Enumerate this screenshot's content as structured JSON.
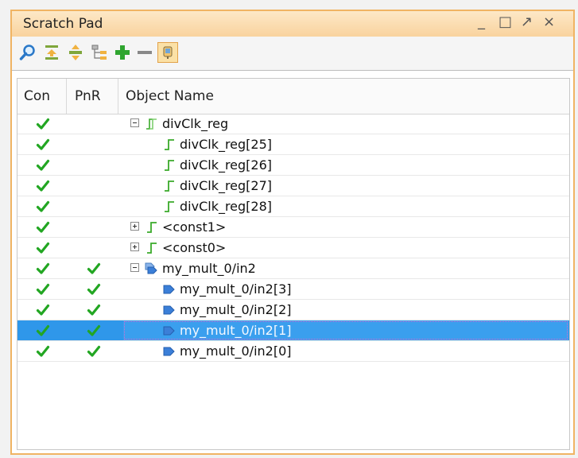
{
  "panel": {
    "title": "Scratch Pad"
  },
  "window_controls": {
    "minimize": "_",
    "maximize": "□",
    "float": "↗",
    "close": "×"
  },
  "toolbar": {
    "icons": [
      "search-icon",
      "collapse-all-icon",
      "expand-all-icon",
      "hierarchy-icon",
      "add-icon",
      "remove-icon",
      "pin-icon"
    ]
  },
  "table": {
    "headers": {
      "con": "Con",
      "pnr": "PnR",
      "object_name": "Object Name"
    },
    "rows": [
      {
        "name": "divClk_reg",
        "con": true,
        "pnr": false,
        "level": 0,
        "expander": "minus",
        "icon": "bus-icon",
        "selected": false
      },
      {
        "name": "divClk_reg[25]",
        "con": true,
        "pnr": false,
        "level": 1,
        "expander": "none",
        "icon": "net-icon",
        "selected": false
      },
      {
        "name": "divClk_reg[26]",
        "con": true,
        "pnr": false,
        "level": 1,
        "expander": "none",
        "icon": "net-icon",
        "selected": false
      },
      {
        "name": "divClk_reg[27]",
        "con": true,
        "pnr": false,
        "level": 1,
        "expander": "none",
        "icon": "net-icon",
        "selected": false
      },
      {
        "name": "divClk_reg[28]",
        "con": true,
        "pnr": false,
        "level": 1,
        "expander": "none",
        "icon": "net-icon",
        "selected": false
      },
      {
        "name": "<const1>",
        "con": true,
        "pnr": false,
        "level": 0,
        "expander": "plus",
        "icon": "net-icon",
        "selected": false
      },
      {
        "name": "<const0>",
        "con": true,
        "pnr": false,
        "level": 0,
        "expander": "plus",
        "icon": "net-icon",
        "selected": false
      },
      {
        "name": "my_mult_0/in2",
        "con": true,
        "pnr": true,
        "level": 0,
        "expander": "minus",
        "icon": "port-bus-icon",
        "selected": false
      },
      {
        "name": "my_mult_0/in2[3]",
        "con": true,
        "pnr": true,
        "level": 1,
        "expander": "none",
        "icon": "port-icon",
        "selected": false
      },
      {
        "name": "my_mult_0/in2[2]",
        "con": true,
        "pnr": true,
        "level": 1,
        "expander": "none",
        "icon": "port-icon",
        "selected": false
      },
      {
        "name": "my_mult_0/in2[1]",
        "con": true,
        "pnr": true,
        "level": 1,
        "expander": "none",
        "icon": "port-icon",
        "selected": true
      },
      {
        "name": "my_mult_0/in2[0]",
        "con": true,
        "pnr": true,
        "level": 1,
        "expander": "none",
        "icon": "port-icon",
        "selected": false
      }
    ]
  }
}
